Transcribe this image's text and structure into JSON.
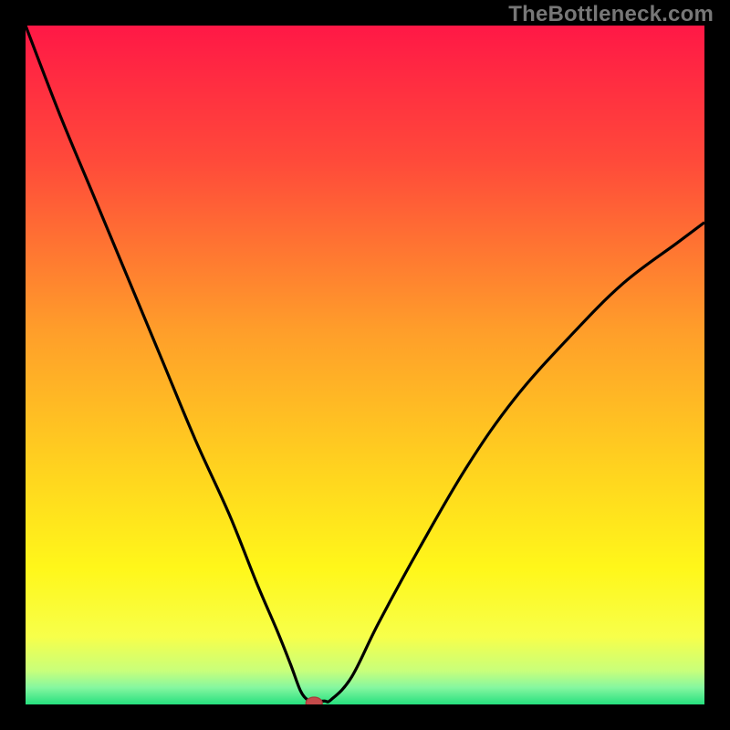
{
  "watermark": "TheBottleneck.com",
  "colors": {
    "frame": "#000000",
    "watermark": "#777777",
    "curve": "#000000",
    "marker_fill": "#c54b4b",
    "marker_stroke": "#a73b3b",
    "gradient_stops": [
      {
        "offset": 0.0,
        "color": "#ff1846"
      },
      {
        "offset": 0.2,
        "color": "#ff4a3a"
      },
      {
        "offset": 0.45,
        "color": "#ff9e2a"
      },
      {
        "offset": 0.65,
        "color": "#ffd21f"
      },
      {
        "offset": 0.8,
        "color": "#fff71a"
      },
      {
        "offset": 0.9,
        "color": "#f7ff4a"
      },
      {
        "offset": 0.95,
        "color": "#c9ff7a"
      },
      {
        "offset": 0.975,
        "color": "#86f7a0"
      },
      {
        "offset": 1.0,
        "color": "#26e07e"
      }
    ]
  },
  "chart_data": {
    "type": "line",
    "title": "",
    "xlabel": "",
    "ylabel": "",
    "xlim": [
      0,
      100
    ],
    "ylim": [
      0,
      100
    ],
    "series": [
      {
        "name": "bottleneck-curve",
        "x": [
          0,
          5,
          10,
          15,
          20,
          25,
          30,
          34,
          37,
          39,
          40.5,
          41.5,
          42,
          44,
          45,
          48,
          52,
          58,
          65,
          72,
          80,
          88,
          96,
          100
        ],
        "y": [
          100,
          87,
          75,
          63,
          51,
          39,
          28,
          18,
          11,
          6,
          2,
          0.7,
          0.5,
          0.5,
          0.7,
          4,
          12,
          23,
          35,
          45,
          54,
          62,
          68,
          71
        ]
      }
    ],
    "marker": {
      "x": 42.5,
      "y": 0.2,
      "label": "optimal-point"
    }
  }
}
